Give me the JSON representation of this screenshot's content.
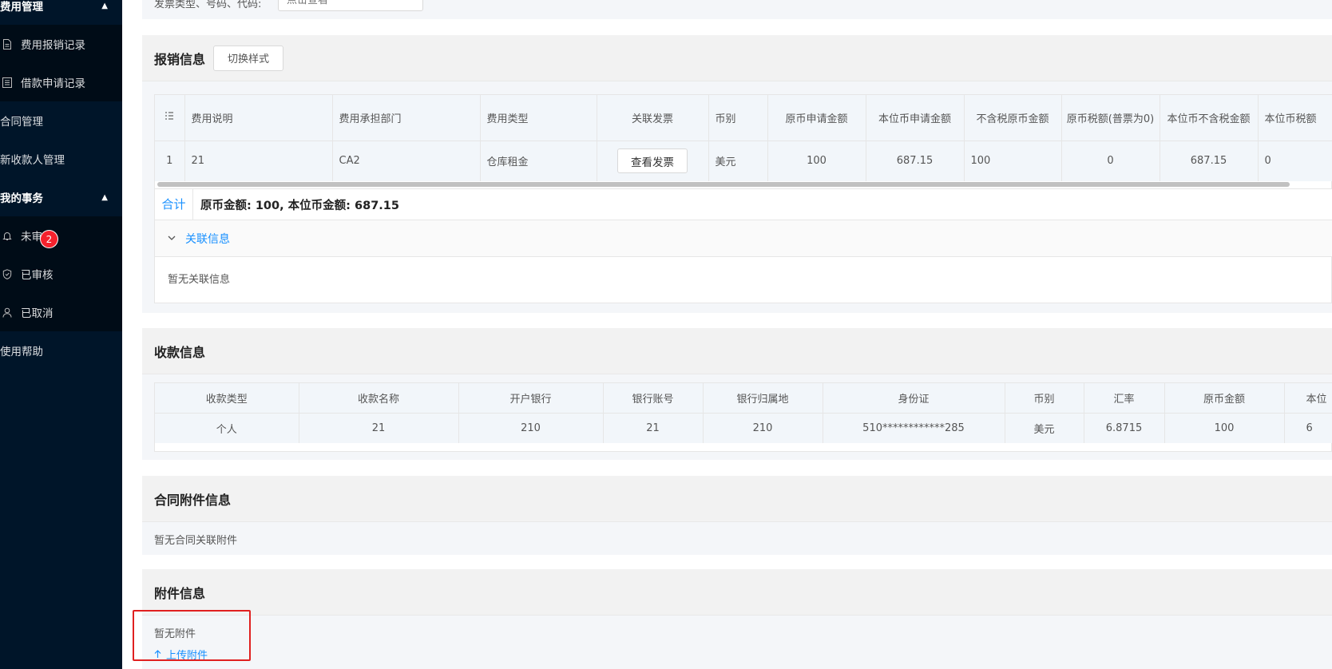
{
  "sidebar": {
    "group_fee": "费用管理",
    "fee_items": [
      "费用报销记录",
      "借款申请记录"
    ],
    "contract": "合同管理",
    "payee": "新收款人管理",
    "group_mine": "我的事务",
    "mine_items": [
      "未审",
      "已审核",
      "已取消"
    ],
    "pending_badge": "2",
    "help": "使用帮助"
  },
  "top": {
    "label": "发票类型、号码、代码:",
    "placeholder": "点击查看"
  },
  "reimburse": {
    "title": "报销信息",
    "switch_btn": "切换样式",
    "headers": [
      "",
      "费用说明",
      "费用承担部门",
      "费用类型",
      "关联发票",
      "币别",
      "原币申请金额",
      "本位币申请金额",
      "不含税原币金额",
      "原币税额(普票为0)",
      "本位币不含税金额",
      "本位币税额"
    ],
    "row": [
      "1",
      "21",
      "CA2",
      "仓库租金",
      "查看发票",
      "美元",
      "100",
      "687.15",
      "100",
      "0",
      "687.15",
      "0"
    ],
    "total_label": "合计",
    "total_text": "原币金额: 100, 本位币金额: 687.15",
    "related_title": "关联信息",
    "related_empty": "暂无关联信息"
  },
  "payment": {
    "title": "收款信息",
    "headers": [
      "收款类型",
      "收款名称",
      "开户银行",
      "银行账号",
      "银行归属地",
      "身份证",
      "币别",
      "汇率",
      "原币金额",
      "本位"
    ],
    "row": [
      "个人",
      "21",
      "210",
      "21",
      "210",
      "510************285",
      "美元",
      "6.8715",
      "100",
      "6"
    ]
  },
  "contract_att": {
    "title": "合同附件信息",
    "empty": "暂无合同关联附件"
  },
  "attachments": {
    "title": "附件信息",
    "empty": "暂无附件",
    "upload": "上传附件"
  }
}
